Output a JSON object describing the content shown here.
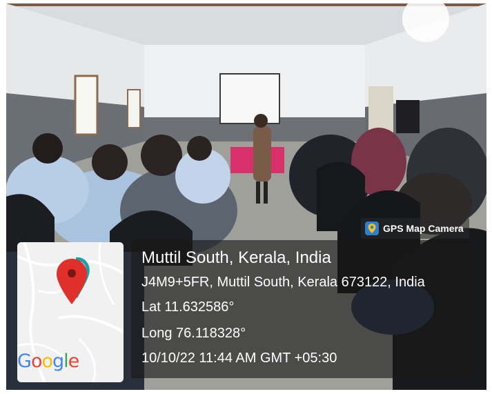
{
  "app_badge": {
    "label": "GPS Map Camera",
    "icon": "map-pin-app-icon"
  },
  "location": {
    "title": "Muttil South, Kerala, India",
    "address": "J4M9+5FR, Muttil South, Kerala 673122, India",
    "latitude": "Lat 11.632586°",
    "longitude": "Long 76.118328°",
    "datetime": "10/10/22 11:44 AM GMT +05:30"
  },
  "map_thumbnail": {
    "logo_text": "Google",
    "pin_color": "#e0302b",
    "logo_colors": [
      "#4285F4",
      "#EA4335",
      "#FBBC05",
      "#4285F4",
      "#34A853",
      "#EA4335"
    ]
  }
}
